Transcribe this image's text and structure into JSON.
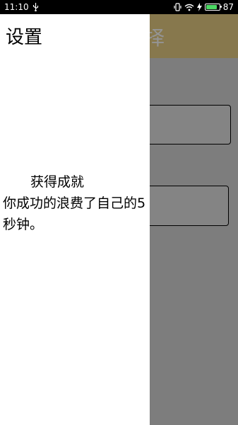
{
  "status_bar": {
    "time": "11:10",
    "battery_level": "87",
    "battery_fraction": 0.87,
    "icons": [
      "usb-icon",
      "vibrate-icon",
      "wifi-icon",
      "charging-icon",
      "battery-icon"
    ]
  },
  "background": {
    "header_text": "择",
    "header_color": "#e8cf85"
  },
  "drawer": {
    "title": "设置",
    "achievement_title": "获得成就",
    "achievement_desc": "你成功的浪费了自己的5秒钟。"
  }
}
